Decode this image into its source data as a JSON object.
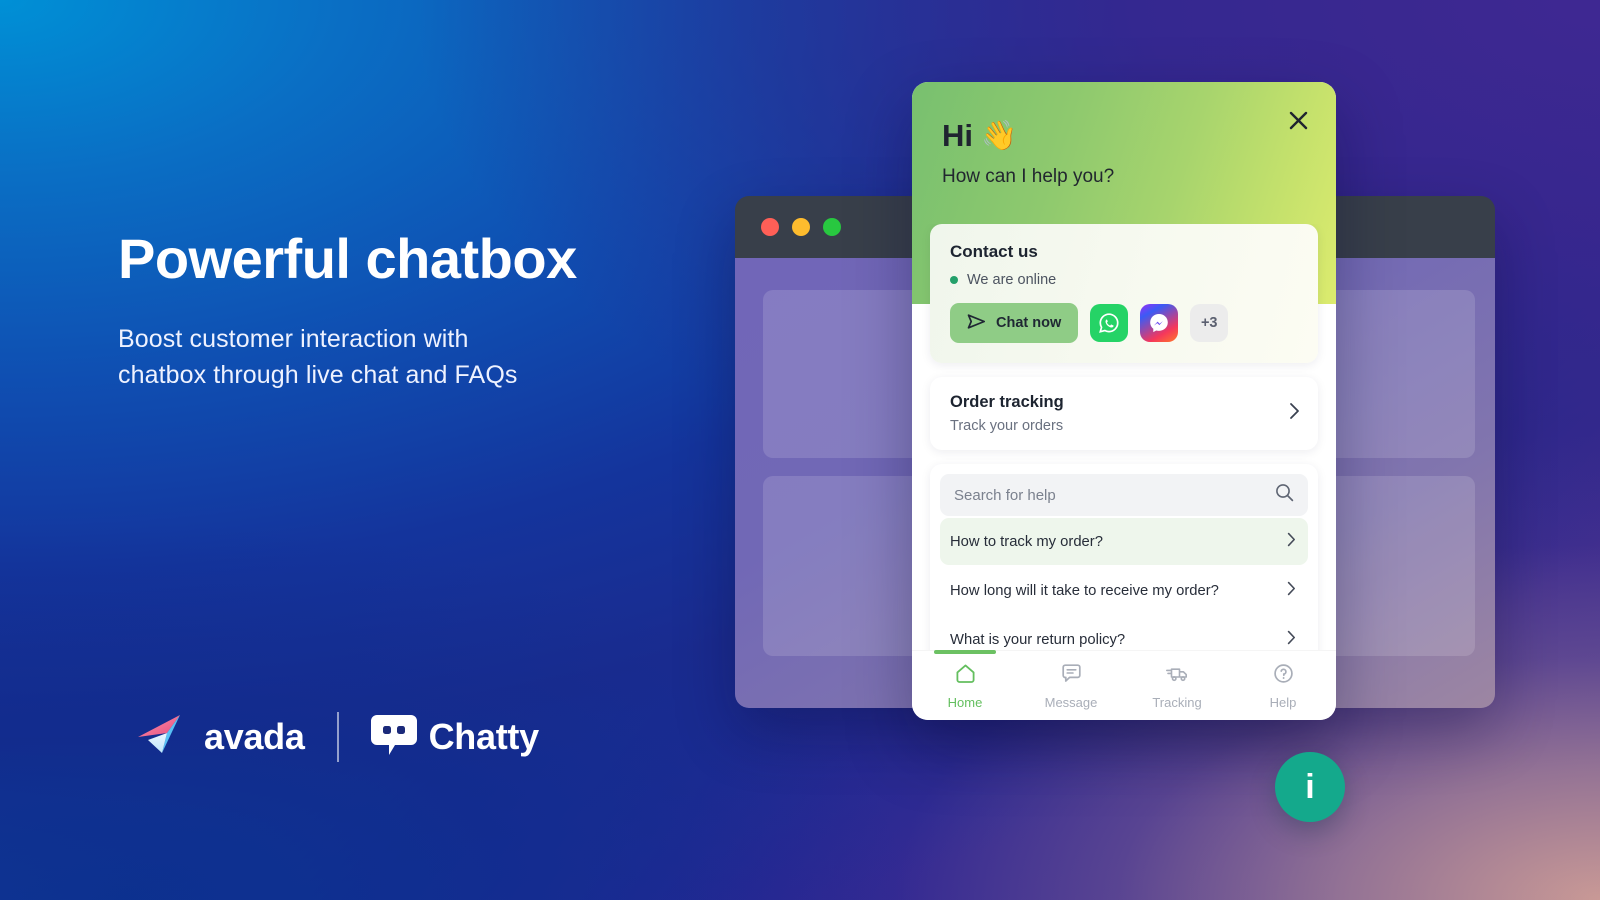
{
  "hero": {
    "headline": "Powerful chatbox",
    "subhead_line1": "Boost customer interaction with",
    "subhead_line2": "chatbox through live chat and FAQs"
  },
  "brand": {
    "avada_name": "avada",
    "chatty_name": "Chatty",
    "avada_icon": "paper-plane-icon",
    "chatty_icon": "chat-bubble-icon",
    "accent_green": "#8fcc86",
    "accent_teal": "#14a98c",
    "header_gradient_start": "#78c06f",
    "header_gradient_end": "#dceb6e"
  },
  "browser_mock": {
    "traffic_lights": [
      "red",
      "yellow",
      "green"
    ],
    "placeholder_count": 2
  },
  "widget": {
    "close_icon": "close-icon",
    "greeting": "Hi",
    "greeting_emoji": "👋",
    "help_prompt": "How can I help you?",
    "contact": {
      "title": "Contact us",
      "status_text": "We are online",
      "status_color": "#23a06a",
      "chat_now_label": "Chat now",
      "send_icon": "send-icon",
      "channels": [
        {
          "name": "whatsapp-icon",
          "label": ""
        },
        {
          "name": "messenger-icon",
          "label": ""
        },
        {
          "name": "more-channels",
          "label": "+3"
        }
      ]
    },
    "order_tracking": {
      "title": "Order tracking",
      "subtitle": "Track your orders",
      "chevron_icon": "chevron-right-icon"
    },
    "help_center": {
      "search_placeholder": "Search for help",
      "search_value": "",
      "search_icon": "search-icon",
      "faqs": [
        {
          "question": "How to track my order?",
          "active": true
        },
        {
          "question": "How long will it take to receive my order?",
          "active": false
        },
        {
          "question": "What is your return policy?",
          "active": false
        }
      ]
    },
    "nav": [
      {
        "label": "Home",
        "icon": "home-icon",
        "active": true
      },
      {
        "label": "Message",
        "icon": "message-icon",
        "active": false
      },
      {
        "label": "Tracking",
        "icon": "truck-icon",
        "active": false
      },
      {
        "label": "Help",
        "icon": "question-circle-icon",
        "active": false
      }
    ]
  },
  "fab": {
    "label": "i",
    "icon": "info-icon"
  }
}
